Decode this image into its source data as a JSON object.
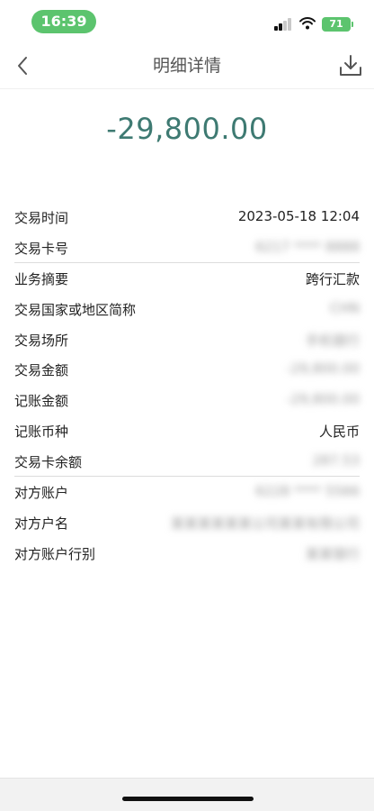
{
  "status_bar": {
    "time": "16:39",
    "battery": "71",
    "colors": {
      "pill": "#5cc46e"
    }
  },
  "nav": {
    "title": "明细详情",
    "back_icon": "chevron-left-icon",
    "download_icon": "download-icon"
  },
  "amount": "-29,800.00",
  "amount_color": "#3e7a72",
  "details": [
    {
      "label": "交易时间",
      "value": "2023-05-18 12:04",
      "blurred": false
    },
    {
      "label": "交易卡号",
      "value": "6217 **** 8888",
      "blurred": true
    },
    {
      "label": "业务摘要",
      "value": "跨行汇款",
      "blurred": false
    },
    {
      "label": "交易国家或地区简称",
      "value": "CHN",
      "blurred": true
    },
    {
      "label": "交易场所",
      "value": "手机银行",
      "blurred": true
    },
    {
      "label": "交易金额",
      "value": "-29,800.00",
      "blurred": true
    },
    {
      "label": "记账金额",
      "value": "-29,800.00",
      "blurred": true
    },
    {
      "label": "记账币种",
      "value": "人民币",
      "blurred": false
    },
    {
      "label": "交易卡余额",
      "value": "287.53",
      "blurred": true
    },
    {
      "label": "对方账户",
      "value": "6228 **** 5566",
      "blurred": true
    },
    {
      "label": "对方户名",
      "value": "某某某某某某公司某某有限公司",
      "blurred": true
    },
    {
      "label": "对方账户行别",
      "value": "某某银行",
      "blurred": true
    }
  ]
}
